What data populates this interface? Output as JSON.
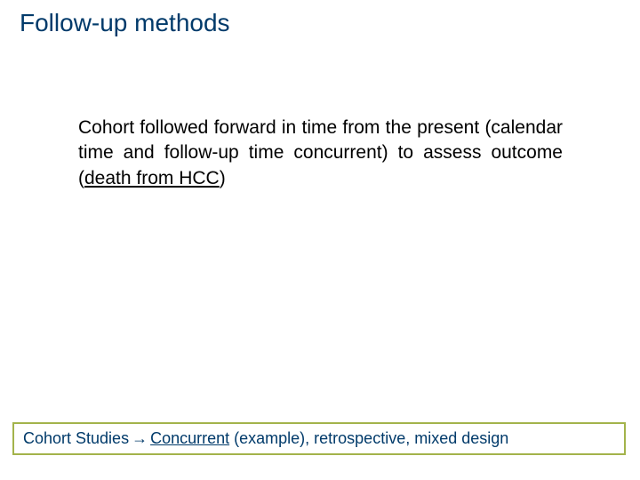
{
  "title": "Follow-up methods",
  "body": {
    "pre": "Cohort followed forward in time from the present (calendar time and follow-up time concurrent) to assess outcome (",
    "underlined": "death from HCC",
    "post": ")"
  },
  "breadcrumb": {
    "first": "Cohort Studies",
    "arrow": "→",
    "second_u": "Concurrent",
    "second_rest": " (example),",
    "third": " retrospective,",
    "fourth": " mixed design"
  }
}
